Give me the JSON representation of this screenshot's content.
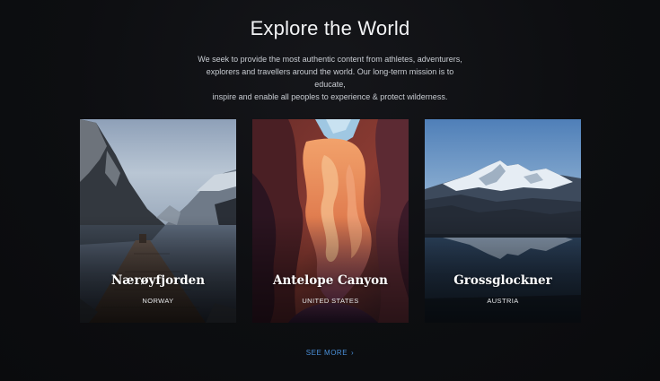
{
  "section": {
    "title": "Explore the World",
    "description_lines": [
      "We seek to provide the most authentic content from athletes, adventurers,",
      "explorers and travellers around the world. Our long-term mission is to educate,",
      "inspire and enable all peoples to experience & protect wilderness."
    ]
  },
  "destinations": [
    {
      "name": "Nærøyfjorden",
      "country": "NORWAY"
    },
    {
      "name": "Antelope Canyon",
      "country": "UNITED STATES"
    },
    {
      "name": "Grossglockner",
      "country": "AUSTRIA"
    }
  ],
  "see_more": {
    "label": "SEE MORE",
    "icon": "chevron-right-icon"
  },
  "colors": {
    "background": "#0d0e11",
    "link": "#4a90d9"
  }
}
